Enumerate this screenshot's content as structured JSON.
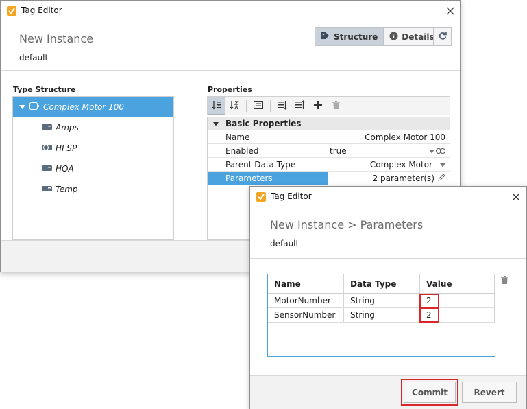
{
  "back": {
    "window_title": "Tag Editor",
    "header_title": "New Instance",
    "provider": "default",
    "structure_label": "Structure",
    "details_label": "Details",
    "type_structure_label": "Type Structure",
    "properties_label": "Properties",
    "tree": [
      {
        "label": "Complex Motor 100",
        "icon": "udt-instance-icon",
        "selected": true
      },
      {
        "label": "Amps",
        "icon": "tag-icon"
      },
      {
        "label": "HI SP",
        "icon": "memory-tag-icon"
      },
      {
        "label": "HOA",
        "icon": "tag-icon"
      },
      {
        "label": "Temp",
        "icon": "tag-icon"
      }
    ],
    "group_label": "Basic Properties",
    "properties": [
      {
        "name": "Name",
        "value": "Complex Motor 100"
      },
      {
        "name": "Enabled",
        "value": "true"
      },
      {
        "name": "Parent Data Type",
        "value": "Complex Motor"
      },
      {
        "name": "Parameters",
        "value": "2 parameter(s)"
      }
    ]
  },
  "front": {
    "window_title": "Tag Editor",
    "header_title": "New Instance > Parameters",
    "provider": "default",
    "columns": [
      "Name",
      "Data Type",
      "Value"
    ],
    "rows": [
      {
        "name": "MotorNumber",
        "type": "String",
        "value": "2"
      },
      {
        "name": "SensorNumber",
        "type": "String",
        "value": "2"
      }
    ],
    "commit_label": "Commit",
    "revert_label": "Revert"
  },
  "colors": {
    "accent": "#4aa3df",
    "highlight": "#d9262b",
    "app_icon": "#f5a524"
  }
}
